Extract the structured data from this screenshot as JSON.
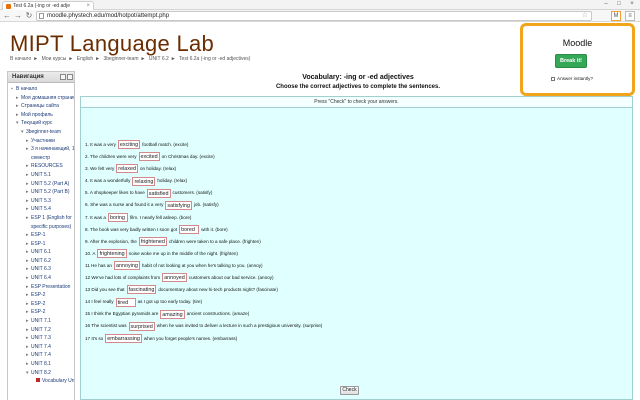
{
  "browser": {
    "tab_title": "Test 6.2a (-ing or -ed adje",
    "url": "moodle.phystech.edu/mod/hotpot/attempt.php",
    "window_buttons": [
      "–",
      "□",
      "×"
    ]
  },
  "site": {
    "title": "MIPT Language Lab",
    "breadcrumb": [
      "В начало",
      "Мои курсы",
      "English",
      "3beginner-team",
      "UNIT 6.2",
      "Test 6.2a (-ing or -ed adjectives)"
    ]
  },
  "sidebar": {
    "header": "Навигация",
    "items": [
      {
        "label": "В начало",
        "indent": 0,
        "bullet": "▪"
      },
      {
        "label": "Моя домашняя страница",
        "indent": 1,
        "bullet": "▸"
      },
      {
        "label": "Страницы сайта",
        "indent": 1,
        "bullet": "▸"
      },
      {
        "label": "Мой профиль",
        "indent": 1,
        "bullet": "▸"
      },
      {
        "label": "Текущий курс",
        "indent": 1,
        "bullet": "▾"
      },
      {
        "label": "3beginner-team",
        "indent": 2,
        "bullet": "▾"
      },
      {
        "label": "Участники",
        "indent": 3,
        "bullet": "▸"
      },
      {
        "label": "3 я начинающий, 1",
        "indent": 3,
        "bullet": "▸"
      },
      {
        "label": "семестр",
        "indent": 3,
        "bullet": ""
      },
      {
        "label": "RESOURCES",
        "indent": 3,
        "bullet": "▸"
      },
      {
        "label": "UNIT 5.1",
        "indent": 3,
        "bullet": "▸"
      },
      {
        "label": "UNIT 5.2 (Part A)",
        "indent": 3,
        "bullet": "▸"
      },
      {
        "label": "UNIT 5.2 (Part B)",
        "indent": 3,
        "bullet": "▸"
      },
      {
        "label": "UNIT 5.3",
        "indent": 3,
        "bullet": "▸"
      },
      {
        "label": "UNIT 5.4",
        "indent": 3,
        "bullet": "▸"
      },
      {
        "label": "ESP 1 (English for",
        "indent": 3,
        "bullet": "▸"
      },
      {
        "label": "specific purposes)",
        "indent": 3,
        "bullet": ""
      },
      {
        "label": "ESP-1",
        "indent": 3,
        "bullet": "▸"
      },
      {
        "label": "ESP-1",
        "indent": 3,
        "bullet": "▸"
      },
      {
        "label": "UNIT 6.1",
        "indent": 3,
        "bullet": "▸"
      },
      {
        "label": "UNIT 6.2",
        "indent": 3,
        "bullet": "▸"
      },
      {
        "label": "UNIT 6.3",
        "indent": 3,
        "bullet": "▸"
      },
      {
        "label": "UNIT 6.4",
        "indent": 3,
        "bullet": "▸"
      },
      {
        "label": "ESP Presentation",
        "indent": 3,
        "bullet": "▸"
      },
      {
        "label": "ESP-2",
        "indent": 3,
        "bullet": "▸"
      },
      {
        "label": "ESP-2",
        "indent": 3,
        "bullet": "▸"
      },
      {
        "label": "ESP-2",
        "indent": 3,
        "bullet": "▸"
      },
      {
        "label": "UNIT 7.1",
        "indent": 3,
        "bullet": "▸"
      },
      {
        "label": "UNIT 7.2",
        "indent": 3,
        "bullet": "▸"
      },
      {
        "label": "UNIT 7.3",
        "indent": 3,
        "bullet": "▸"
      },
      {
        "label": "UNIT 7.4",
        "indent": 3,
        "bullet": "▸"
      },
      {
        "label": "UNIT 7.4",
        "indent": 3,
        "bullet": "▸"
      },
      {
        "label": "UNIT 8.1",
        "indent": 3,
        "bullet": "▸"
      },
      {
        "label": "UNIT 8.2",
        "indent": 3,
        "bullet": "▾"
      },
      {
        "label": "Vocabulary Unit",
        "indent": 4,
        "bullet": "",
        "icon": true
      }
    ]
  },
  "quiz": {
    "heading": "Vocabulary: -ing or -ed adjectives",
    "instruction": "Choose the correct adjectives to complete the sentences.",
    "hint": "Press \"Check\" to check your answers.",
    "check_label": "Check",
    "questions": [
      {
        "before": "1. It was a very",
        "answer": "exciting",
        "after": "football match. (excite)"
      },
      {
        "before": "2. The children were very",
        "answer": "excited",
        "after": "on Christmas day. (excite)"
      },
      {
        "before": "3. We felt very",
        "answer": "relaxed",
        "after": "on holiday. (relax)"
      },
      {
        "before": "4. It was a wonderfully",
        "answer": "relaxing",
        "after": "holiday. (relax)"
      },
      {
        "before": "5. A shopkeeper likes to have",
        "answer": "satisfied",
        "after": "customers. (satisfy)"
      },
      {
        "before": "6. She was a nurse and found it a very",
        "answer": "satisfying",
        "after": "job. (satisfy)"
      },
      {
        "before": "7. It was a",
        "answer": "boring",
        "after": "film. I nearly fell asleep. (bore)"
      },
      {
        "before": "8. The book was very badly written I soon got",
        "answer": "bored",
        "after": "with it. (bore)"
      },
      {
        "before": "9. After the explosion, the",
        "answer": "frightened",
        "after": "children were taken to a safe place. (frighten)"
      },
      {
        "before": "10. A",
        "answer": "frightening",
        "after": "noise woke me up in the middle of the night. (frighten)"
      },
      {
        "before": "11 He has an",
        "answer": "annoying",
        "after": "habit of not looking at you when he's talking to you. (annoy)"
      },
      {
        "before": "12 We've had lots of complaints from",
        "answer": "annoyed",
        "after": "customers about our bad service. (annoy)"
      },
      {
        "before": "13 Did you see that",
        "answer": "fascinating",
        "after": "documentary about new hi-tech products night? (fascinate)"
      },
      {
        "before": "14 I feel really",
        "answer": "tired",
        "after": "as I got up too early today. (tire)"
      },
      {
        "before": "15 I think the Egyptian pyramids are",
        "answer": "amazing",
        "after": "ancient constructions. (amaze)"
      },
      {
        "before": "16 The scientist was",
        "answer": "surprised",
        "after": "when he was invited to deliver a lecture in such a prestigious university. (surprise)"
      },
      {
        "before": "17 It's so",
        "answer": "embarrassing",
        "after": "when you forget people's names. (embarrass)"
      }
    ]
  },
  "popup": {
    "title": "Moodle",
    "button_label": "Break it!",
    "checkbox_label": "Answer instantly?",
    "accent_color": "#f2a51a",
    "button_color": "#34a856"
  }
}
